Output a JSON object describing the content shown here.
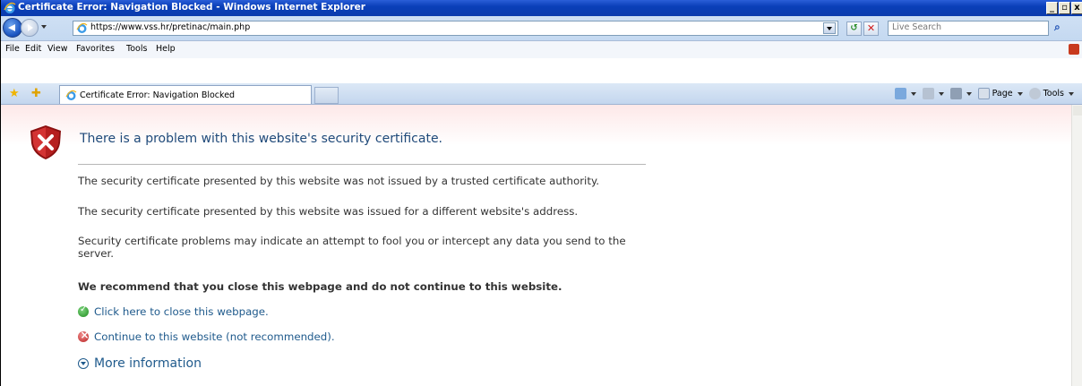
{
  "window": {
    "title": "Certificate Error: Navigation Blocked - Windows Internet Explorer",
    "min_label": "_",
    "max_label": "▫",
    "close_label": "x"
  },
  "address_bar": {
    "url": "https://www.vss.hr/pretinac/main.php",
    "search_placeholder": "Live Search"
  },
  "menu": {
    "file": "File",
    "edit": "Edit",
    "view": "View",
    "favorites": "Favorites",
    "tools": "Tools",
    "help": "Help"
  },
  "tabs": {
    "active_label": "Certificate Error: Navigation Blocked"
  },
  "command_bar": {
    "page_label": "Page",
    "tools_label": "Tools"
  },
  "content": {
    "heading": "There is a problem with this website's security certificate.",
    "para1": "The security certificate presented by this website was not issued by a trusted certificate authority.",
    "para2": "The security certificate presented by this website was issued for a different website's address.",
    "para3": "Security certificate problems may indicate an attempt to fool you or intercept any data you send to the server.",
    "recommendation": "We recommend that you close this webpage and do not continue to this website.",
    "close_link": "Click here to close this webpage.",
    "continue_link": "Continue to this website (not recommended).",
    "more_info": "More information"
  },
  "colors": {
    "title_bar": "#0a3fb8",
    "heading_text": "#1f4a7a",
    "link_text": "#1f5a8c",
    "shield_red": "#c62828"
  }
}
